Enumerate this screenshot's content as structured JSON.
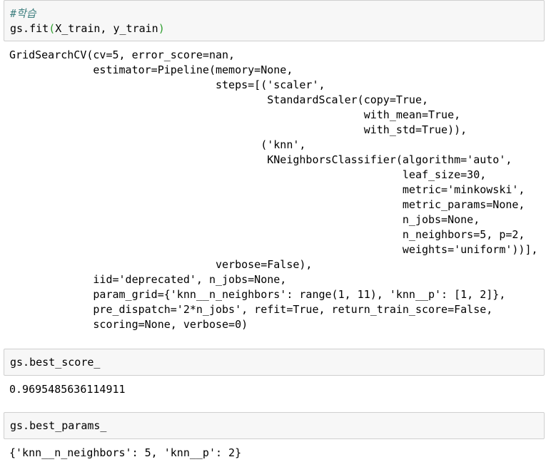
{
  "cells": [
    {
      "input": {
        "comment": "#학습",
        "code_prefix": "gs.fit",
        "paren_open": "(",
        "args": "X_train, y_train",
        "paren_close": ")"
      },
      "output_lines": [
        "GridSearchCV(cv=5, error_score=nan,",
        "             estimator=Pipeline(memory=None,",
        "                                steps=[('scaler',",
        "                                        StandardScaler(copy=True,",
        "                                                       with_mean=True,",
        "                                                       with_std=True)),",
        "                                       ('knn',",
        "                                        KNeighborsClassifier(algorithm='auto',",
        "                                                             leaf_size=30,",
        "                                                             metric='minkowski',",
        "                                                             metric_params=None,",
        "                                                             n_jobs=None,",
        "                                                             n_neighbors=5, p=2,",
        "                                                             weights='uniform'))],",
        "                                verbose=False),",
        "             iid='deprecated', n_jobs=None,",
        "             param_grid={'knn__n_neighbors': range(1, 11), 'knn__p': [1, 2]},",
        "             pre_dispatch='2*n_jobs', refit=True, return_train_score=False,",
        "             scoring=None, verbose=0)"
      ]
    },
    {
      "input": {
        "code": "gs.best_score_"
      },
      "output": "0.9695485636114911"
    },
    {
      "input": {
        "code": "gs.best_params_"
      },
      "output": "{'knn__n_neighbors': 5, 'knn__p': 2}"
    }
  ]
}
